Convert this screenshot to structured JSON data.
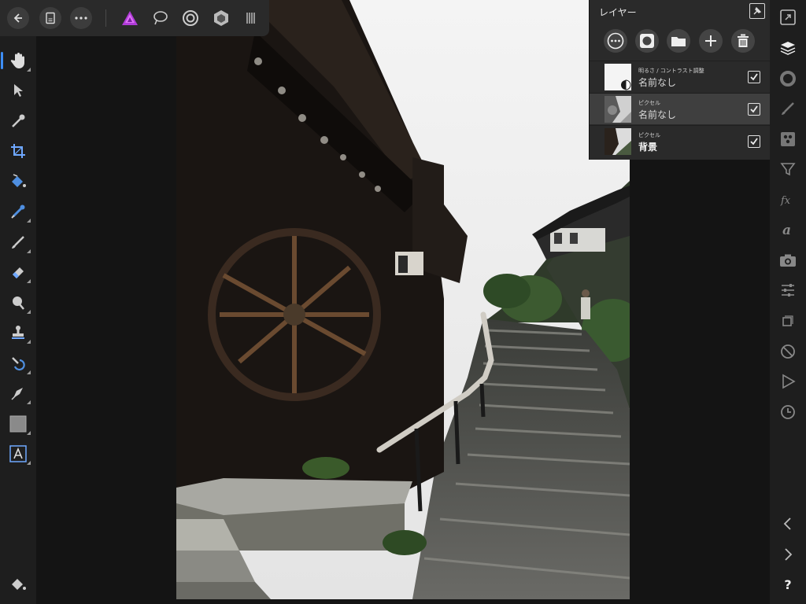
{
  "colors": {
    "accent": "#3d8df5",
    "brand": "#c040e0",
    "panel": "#2a2a2a",
    "toolbar": "#1e1e1e"
  },
  "topbar": {
    "buttons": [
      "back-icon",
      "document-icon",
      "more-icon"
    ],
    "personas": [
      "photo-persona-icon",
      "liquify-persona-icon",
      "develop-persona-icon",
      "tone-mapping-persona-icon",
      "export-persona-icon"
    ]
  },
  "left_tools": [
    "view-tool-icon",
    "move-tool-icon",
    "color-picker-icon",
    "crop-icon",
    "flood-fill-icon",
    "selection-brush-icon",
    "paint-brush-icon",
    "erase-brush-icon",
    "dodge-brush-icon",
    "clone-brush-icon",
    "healing-brush-icon",
    "pen-tool-icon",
    "rectangle-tool-icon",
    "artistic-text-icon",
    "fill-bucket-icon"
  ],
  "right_tools": [
    "navigator-icon",
    "layers-icon",
    "color-icon",
    "brushes-icon",
    "channels-icon",
    "adjustments-icon",
    "effects-icon",
    "text-styles-icon",
    "stock-icon",
    "transform-icon",
    "selection-icon",
    "disable-icon",
    "macro-icon",
    "history-icon",
    "chevron-left-icon",
    "chevron-right-icon",
    "help-icon"
  ],
  "layers_panel": {
    "title": "レイヤー",
    "toolbar": [
      "layer-options-icon",
      "mask-icon",
      "group-icon",
      "add-layer-icon",
      "delete-layer-icon"
    ],
    "layers": [
      {
        "type": "明るさ / コントラスト調整",
        "name": "名前なし",
        "visible": true,
        "selected": false
      },
      {
        "type": "ピクセル",
        "name": "名前なし",
        "visible": true,
        "selected": true
      },
      {
        "type": "ピクセル",
        "name": "背景",
        "visible": true,
        "selected": false
      }
    ]
  },
  "help_label": "?"
}
